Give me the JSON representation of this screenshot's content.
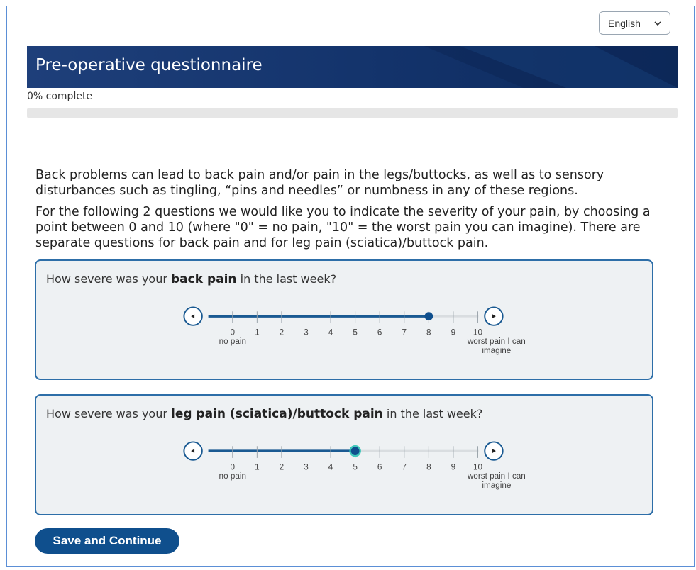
{
  "language": {
    "selected": "English"
  },
  "header": {
    "title": "Pre-operative questionnaire"
  },
  "progress": {
    "label": "0% complete",
    "value": 0
  },
  "intro": {
    "p1": "Back problems can lead to back pain and/or pain in the legs/buttocks, as well as to sensory disturbances such as tingling, “pins and needles” or numbness in any of these regions.",
    "p2": "For the following 2 questions we would like you to indicate the severity of your pain, by choosing a point between 0 and 10 (where \"0\" = no pain, \"10\" = the worst pain you can imagine). There are separate questions for back pain and for leg pain (sciatica)/buttock pain."
  },
  "questions": [
    {
      "prefix": "How severe was your ",
      "bold": "back pain",
      "suffix": " in the last week?",
      "value": 8
    },
    {
      "prefix": "How severe was your ",
      "bold": "leg pain (sciatica)/buttock pain",
      "suffix": " in the last week?",
      "value": 5
    }
  ],
  "scale": {
    "ticks": [
      "0",
      "1",
      "2",
      "3",
      "4",
      "5",
      "6",
      "7",
      "8",
      "9",
      "10"
    ],
    "min_label": "no pain",
    "max_label_line1": "worst pain I can",
    "max_label_line2": "imagine"
  },
  "actions": {
    "save_label": "Save and Continue"
  },
  "colors": {
    "accent": "#0f4f8d",
    "track_active": "#1a5a92",
    "track_inactive": "#d9dde0",
    "thumb_q2_glow": "#2ec4b6"
  },
  "icons": {
    "decrement": "chevron-left-circle-icon",
    "increment": "chevron-right-circle-icon",
    "dropdown": "chevron-down-icon"
  }
}
